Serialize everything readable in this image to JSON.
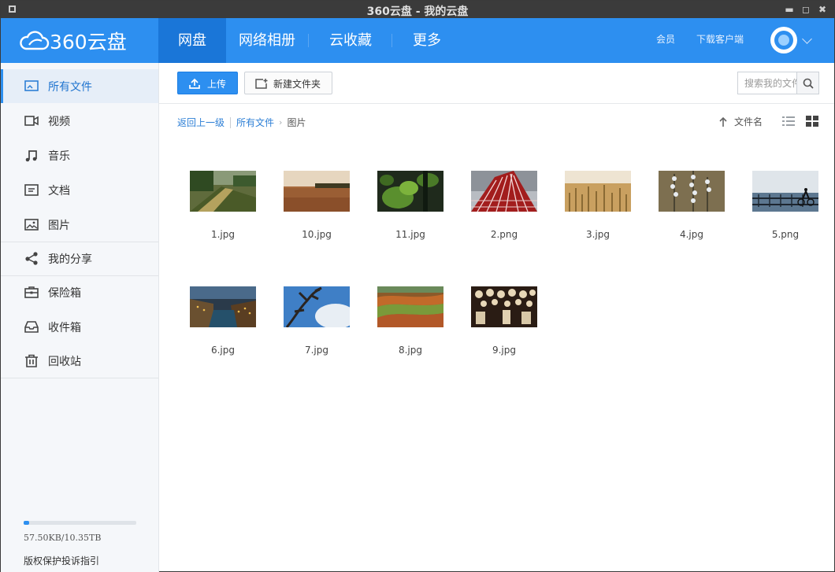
{
  "window": {
    "title": "360云盘 - 我的云盘"
  },
  "brand": {
    "logo_text": "360云盘"
  },
  "nav": {
    "tabs": [
      "网盘",
      "网络相册",
      "云收藏",
      "更多"
    ],
    "active_tab": "网盘",
    "links": [
      "会员",
      "下载客户端"
    ]
  },
  "sidebar": {
    "items": [
      {
        "label": "所有文件",
        "icon": "all-files-icon",
        "active": true
      },
      {
        "label": "视频",
        "icon": "video-icon"
      },
      {
        "label": "音乐",
        "icon": "music-icon"
      },
      {
        "label": "文档",
        "icon": "document-icon"
      },
      {
        "label": "图片",
        "icon": "image-icon"
      },
      {
        "label": "我的分享",
        "icon": "share-icon"
      },
      {
        "label": "保险箱",
        "icon": "safe-box-icon"
      },
      {
        "label": "收件箱",
        "icon": "inbox-icon"
      },
      {
        "label": "回收站",
        "icon": "trash-icon"
      }
    ],
    "storage": {
      "text": "57.50KB/10.35TB",
      "used_fraction": 0.05
    },
    "report_link": "版权保护投诉指引"
  },
  "toolbar": {
    "upload_label": "上传",
    "new_folder_label": "新建文件夹",
    "search_placeholder": "搜索我的文件"
  },
  "breadcrumb": {
    "back": "返回上一级",
    "path": [
      "所有文件"
    ],
    "current": "图片"
  },
  "sort": {
    "label": "文件名"
  },
  "files": [
    {
      "name": "1.jpg"
    },
    {
      "name": "10.jpg"
    },
    {
      "name": "11.jpg"
    },
    {
      "name": "2.png"
    },
    {
      "name": "3.jpg"
    },
    {
      "name": "4.jpg"
    },
    {
      "name": "5.png"
    },
    {
      "name": "6.jpg"
    },
    {
      "name": "7.jpg"
    },
    {
      "name": "8.jpg"
    },
    {
      "name": "9.jpg"
    }
  ],
  "colors": {
    "brand_blue": "#2d8ff0",
    "active_tab": "#1a76d8",
    "link": "#2d7fd6"
  }
}
